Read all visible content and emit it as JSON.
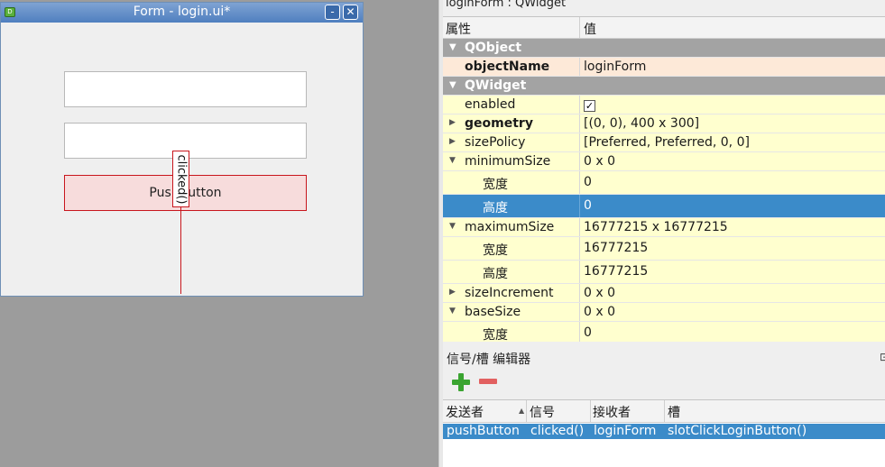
{
  "form_window": {
    "title": "Form - login.ui*",
    "app_icon_text": "D",
    "minimize_label": "-",
    "close_label": "✕",
    "push_button_label": "PushButton",
    "connection_signal": "clicked()"
  },
  "property_editor": {
    "header": "loginForm : QWidget",
    "col_property": "属性",
    "col_value": "值",
    "rows": [
      {
        "name": "QObject",
        "value": ""
      },
      {
        "name": "objectName",
        "value": "loginForm"
      },
      {
        "name": "QWidget",
        "value": ""
      },
      {
        "name": "enabled",
        "value": "✓"
      },
      {
        "name": "geometry",
        "value": "[(0, 0), 400 x 300]"
      },
      {
        "name": "sizePolicy",
        "value": "[Preferred, Preferred, 0, 0]"
      },
      {
        "name": "minimumSize",
        "value": "0 x 0"
      },
      {
        "name": "宽度",
        "value": "0"
      },
      {
        "name": "高度",
        "value": "0"
      },
      {
        "name": "maximumSize",
        "value": "16777215 x 16777215"
      },
      {
        "name": "宽度",
        "value": "16777215"
      },
      {
        "name": "高度",
        "value": "16777215"
      },
      {
        "name": "sizeIncrement",
        "value": "0 x 0"
      },
      {
        "name": "baseSize",
        "value": "0 x 0"
      },
      {
        "name": "宽度",
        "value": "0"
      }
    ]
  },
  "signal_slot_editor": {
    "title": "信号/槽 编辑器",
    "columns": [
      "发送者",
      "信号",
      "接收者",
      "槽"
    ],
    "connections": [
      {
        "sender": "pushButton",
        "signal": "clicked()",
        "receiver": "loginForm",
        "slot": "slotClickLoginButton()"
      }
    ]
  }
}
